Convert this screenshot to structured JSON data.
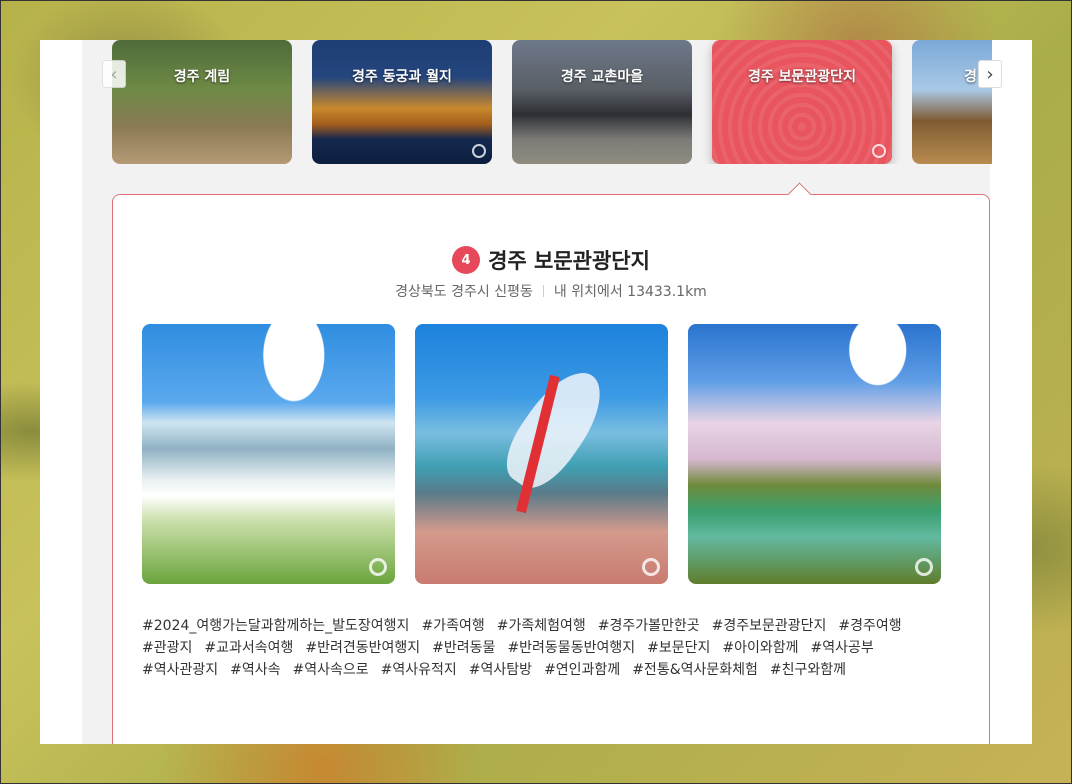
{
  "carousel": {
    "items": [
      {
        "label": "경주 계림"
      },
      {
        "label": "경주 동궁과 월지"
      },
      {
        "label": "경주 교촌마을"
      },
      {
        "label": "경주 보문관광단지"
      },
      {
        "label": "경"
      }
    ],
    "prev_icon": "chevron-left-icon",
    "next_icon": "chevron-right-icon",
    "prev_symbol": "‹",
    "next_symbol": "›",
    "active_index": 3
  },
  "detail": {
    "number": "4",
    "title": "경주 보문관광단지",
    "address": "경상북도 경주시 신평동",
    "distance": "내 위치에서 13433.1km",
    "tags": [
      "#2024_여행가는달과함께하는_발도장여행지",
      "#가족여행",
      "#가족체험여행",
      "#경주가볼만한곳",
      "#경주보문관광단지",
      "#경주여행",
      "#관광지",
      "#교과서속여행",
      "#반려견동반여행지",
      "#반려동물",
      "#반려동물동반여행지",
      "#보문단지",
      "#아이와함께",
      "#역사공부",
      "#역사관광지",
      "#역사속",
      "#역사속으로",
      "#역사유적지",
      "#역사탐방",
      "#연인과함께",
      "#전통&역사문화체험",
      "#친구와함께"
    ]
  },
  "colors": {
    "accent": "#e6495a",
    "active_card": "#e8555e",
    "border": "#e07078"
  }
}
